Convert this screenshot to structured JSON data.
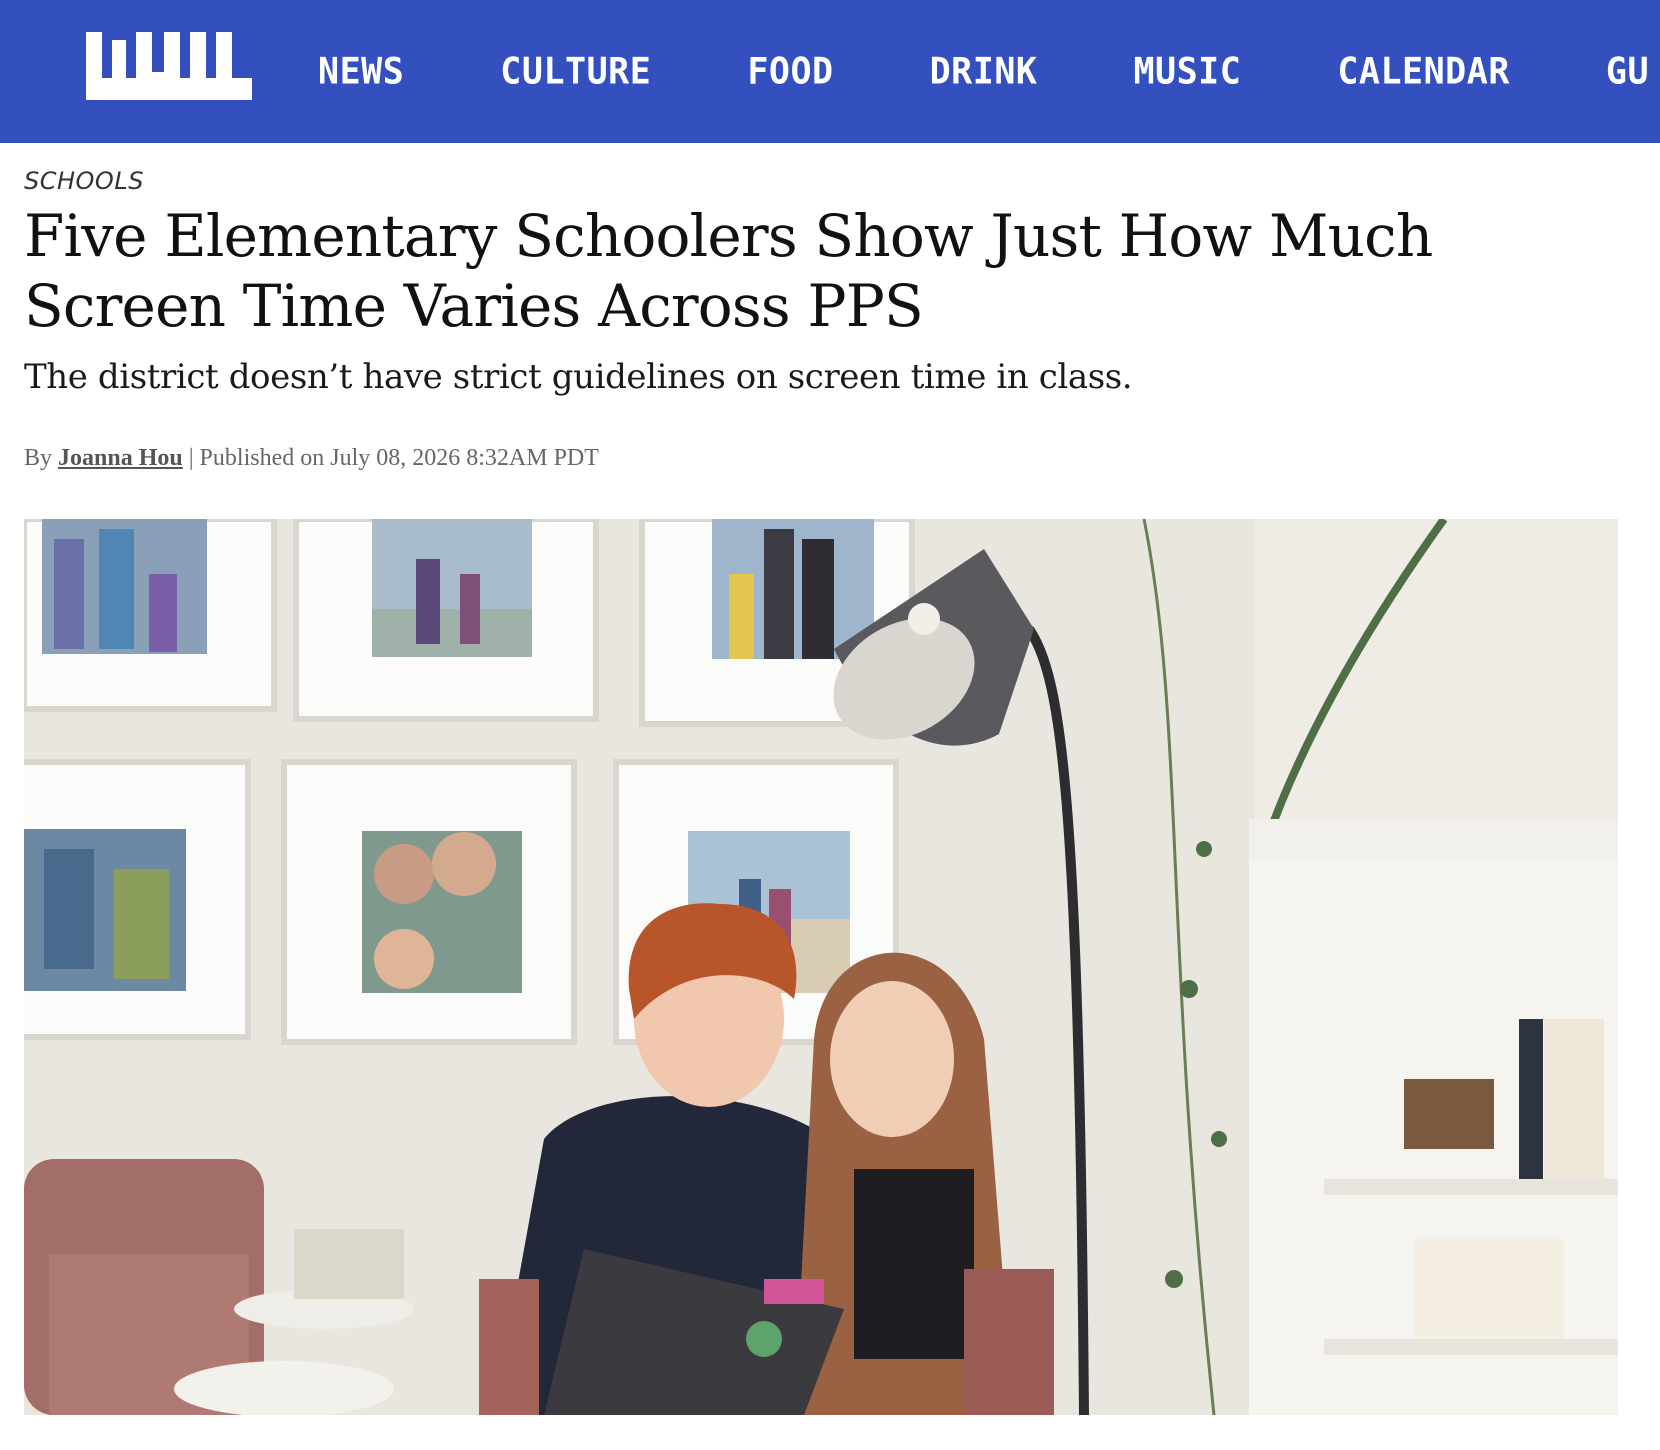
{
  "site": {
    "logo_text": "WW",
    "brand_color": "#3450bf"
  },
  "nav": {
    "items": [
      {
        "label": "NEWS"
      },
      {
        "label": "CULTURE"
      },
      {
        "label": "FOOD"
      },
      {
        "label": "DRINK"
      },
      {
        "label": "MUSIC"
      },
      {
        "label": "CALENDAR"
      },
      {
        "label": "GU"
      }
    ]
  },
  "article": {
    "section": "SCHOOLS",
    "headline": "Five Elementary Schoolers Show Just How Much Screen Time Varies Across PPS",
    "dek": "The district doesn’t have strict guidelines on screen time in class.",
    "byline_prefix": "By",
    "author": "Joanna Hou",
    "separator": "|",
    "published": "Published on July 08, 2026 8:32AM PDT"
  },
  "hero_image": {
    "description_icon": "photo-icon"
  }
}
